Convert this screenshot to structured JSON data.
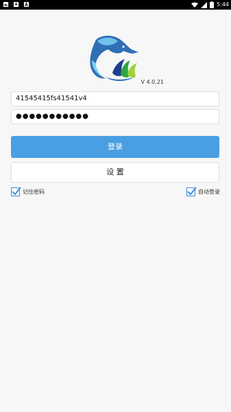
{
  "status_bar": {
    "time": "5:44",
    "left_icons": [
      "image-icon",
      "download-icon",
      "text-icon"
    ],
    "right_icons": [
      "wifi-icon",
      "signal-icon",
      "battery-icon"
    ]
  },
  "logo": {
    "icon": "dolphin-logo-icon"
  },
  "version": "V 4.0.21",
  "account_field": {
    "value": "41545415fs41541v4"
  },
  "password_field": {
    "value": "●●●●●●●●●●●"
  },
  "login_button": {
    "label": "登录"
  },
  "settings_button": {
    "label": "设 置"
  },
  "remember_password": {
    "label": "记住密码",
    "checked": true
  },
  "auto_login": {
    "label": "自动登录",
    "checked": true
  },
  "colors": {
    "primary": "#4a9fe2",
    "checkbox": "#3e8ad8"
  }
}
